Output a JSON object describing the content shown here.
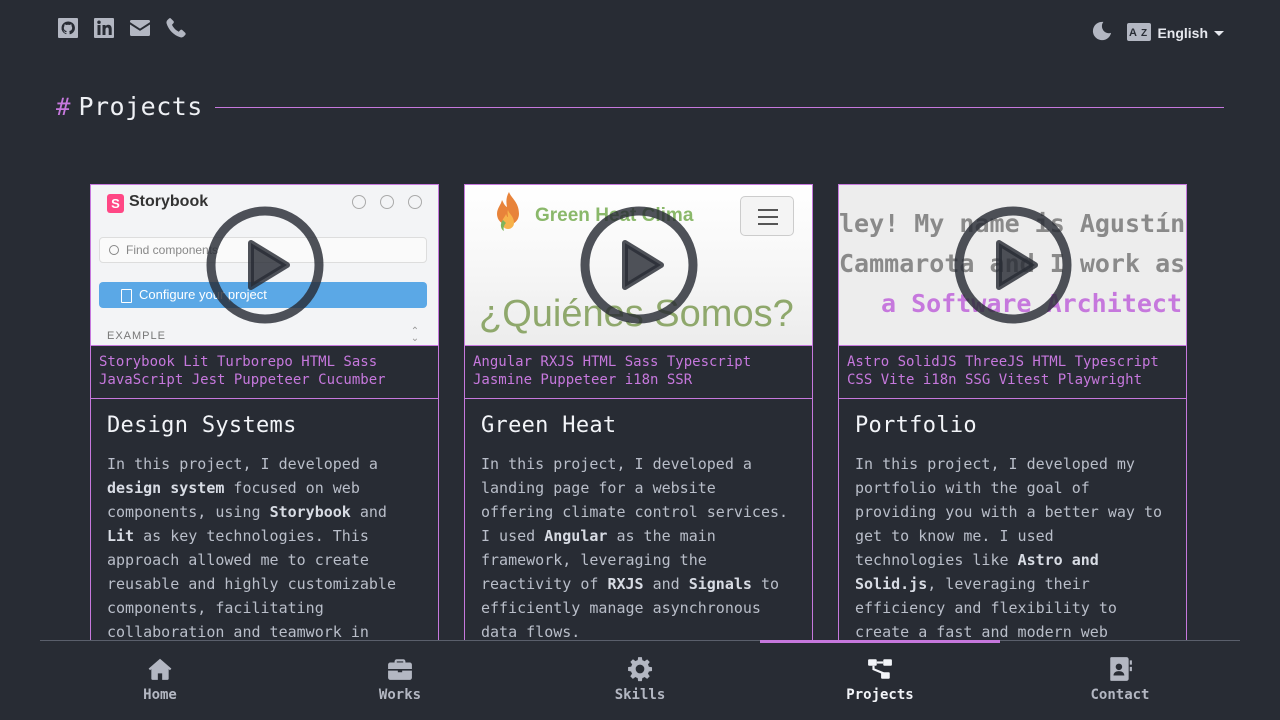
{
  "header": {
    "social": [
      "github-icon",
      "linkedin-icon",
      "mail-icon",
      "phone-icon"
    ],
    "theme_icon": "moon-icon",
    "language": "English"
  },
  "section": {
    "hash": "#",
    "title": "Projects"
  },
  "projects": [
    {
      "thumbnail": {
        "app_name": "Storybook",
        "logo_letter": "S",
        "search_placeholder": "Find components",
        "button_label": "Configure your project",
        "section_label": "EXAMPLE"
      },
      "tags_line1": "Storybook Lit Turborepo HTML Sass",
      "tags_line2": "JavaScript Jest Puppeteer Cucumber",
      "title": "Design Systems",
      "desc": [
        {
          "t": "In this project, I developed a "
        },
        {
          "t": "design system",
          "b": true
        },
        {
          "t": " focused on web components, using "
        },
        {
          "t": "Storybook",
          "b": true
        },
        {
          "t": " and "
        },
        {
          "t": "Lit",
          "b": true
        },
        {
          "t": " as key technologies. This approach allowed me to create reusable and highly customizable components, facilitating collaboration and teamwork in development."
        }
      ]
    },
    {
      "thumbnail": {
        "app_name": "Green Heat Clima",
        "heading": "¿Quiénes Somos?"
      },
      "tags_line1": "Angular RXJS HTML Sass Typescript",
      "tags_line2": "Jasmine Puppeteer i18n SSR",
      "title": "Green Heat",
      "desc": [
        {
          "t": "In this project, I developed a landing page for a website offering climate control services. I used "
        },
        {
          "t": "Angular",
          "b": true
        },
        {
          "t": " as the main framework, leveraging the reactivity of "
        },
        {
          "t": "RXJS",
          "b": true
        },
        {
          "t": " and "
        },
        {
          "t": "Signals",
          "b": true
        },
        {
          "t": " to efficiently manage asynchronous data flows."
        }
      ]
    },
    {
      "thumbnail": {
        "line1": "ley! My name is Agustín",
        "line2": "Cammarota and I work as",
        "line3": "a Software Architect"
      },
      "tags_line1": "Astro SolidJS ThreeJS HTML Typescript",
      "tags_line2": "CSS Vite i18n SSG Vitest Playwright",
      "title": "Portfolio",
      "desc": [
        {
          "t": "In this project, I developed my portfolio with the goal of providing you with a better way to get to know me. I used technologies like "
        },
        {
          "t": "Astro and Solid.js",
          "b": true
        },
        {
          "t": ", leveraging their efficiency and flexibility to create a fast and modern web experience."
        }
      ]
    }
  ],
  "nav": [
    {
      "label": "Home",
      "icon": "home-icon"
    },
    {
      "label": "Works",
      "icon": "briefcase-icon"
    },
    {
      "label": "Skills",
      "icon": "gear-icon"
    },
    {
      "label": "Projects",
      "icon": "diagram-icon",
      "active": true
    },
    {
      "label": "Contact",
      "icon": "contact-book-icon"
    }
  ],
  "colors": {
    "background": "#282c34",
    "accent": "#c678dd",
    "text": "#d4d6dc"
  }
}
